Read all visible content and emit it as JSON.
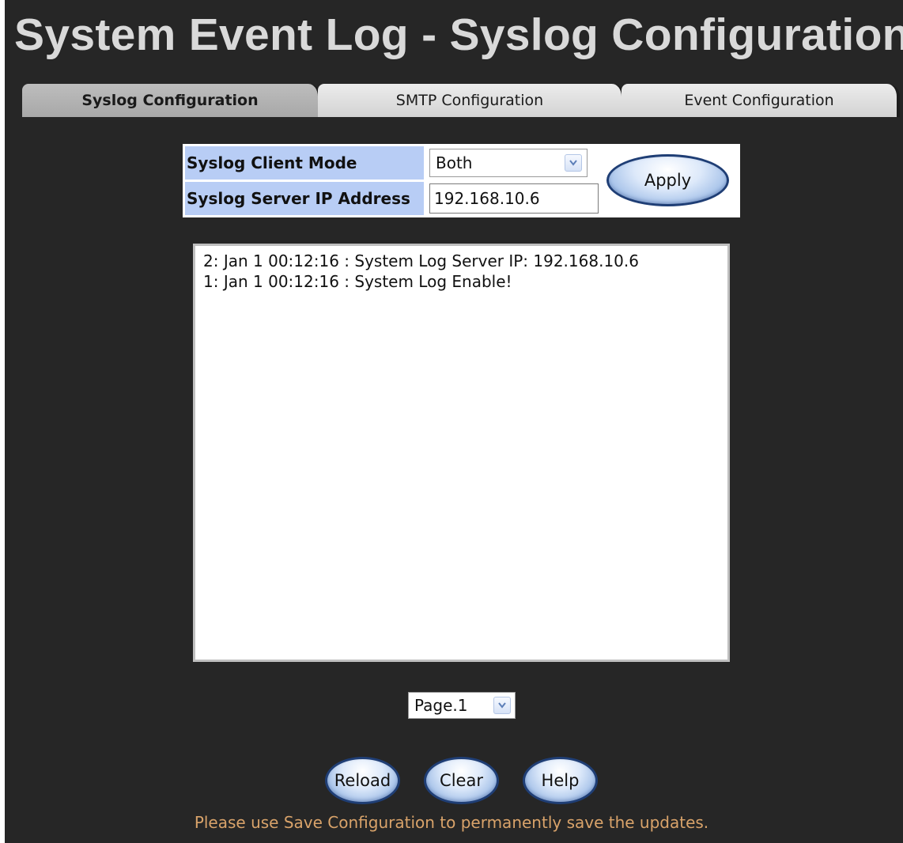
{
  "page": {
    "title": "System Event Log - Syslog Configuration"
  },
  "tabs": [
    {
      "label": "Syslog Configuration",
      "active": true
    },
    {
      "label": "SMTP Configuration",
      "active": false
    },
    {
      "label": "Event Configuration",
      "active": false
    }
  ],
  "config": {
    "client_mode_label": "Syslog Client Mode",
    "client_mode_value": "Both",
    "server_ip_label": "Syslog Server IP Address",
    "server_ip_value": "192.168.10.6",
    "apply_label": "Apply"
  },
  "log": {
    "lines": [
      "2: Jan 1 00:12:16 : System Log Server IP: 192.168.10.6",
      "1: Jan 1 00:12:16 : System Log Enable!"
    ]
  },
  "pager": {
    "selected": "Page.1"
  },
  "actions": {
    "reload_label": "Reload",
    "clear_label": "Clear",
    "help_label": "Help"
  },
  "notice": "Please use Save Configuration to permanently save the updates.",
  "colors": {
    "background": "#262626",
    "label_bg": "#b8cdf5",
    "notice_text": "#d9a36a",
    "button_border": "#1f3e75"
  },
  "icons": {
    "dropdown": "chevron-down-icon"
  }
}
